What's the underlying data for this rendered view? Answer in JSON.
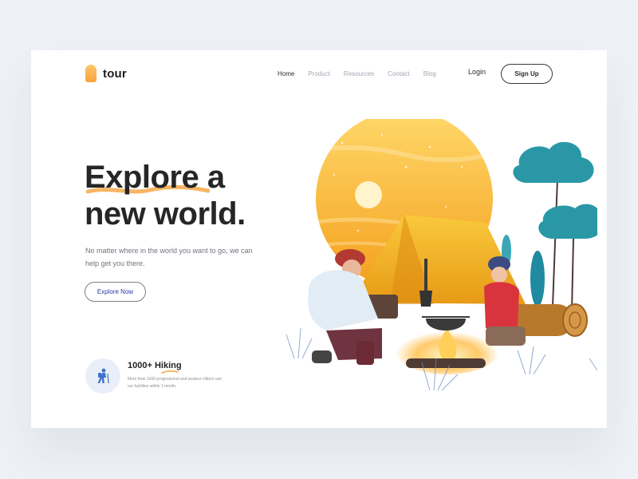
{
  "brand": {
    "name": "tour",
    "accent": "#f7a33a"
  },
  "nav": {
    "items": [
      {
        "label": "Home",
        "active": true
      },
      {
        "label": "Product",
        "active": false
      },
      {
        "label": "Resources",
        "active": false
      },
      {
        "label": "Contact",
        "active": false
      },
      {
        "label": "Blog",
        "active": false
      }
    ],
    "login_label": "Login",
    "signup_label": "Sign Up"
  },
  "hero": {
    "title_line1": "Explore a",
    "title_line2": "new world.",
    "subtitle": "No matter where in the world you want to go, we can help get you there.",
    "cta_label": "Explore Now"
  },
  "stat": {
    "title": "1000+ Hiking",
    "description": "More than 1000 progessional and acateur clibers use our facilities within 1 month.",
    "icon": "hiker-icon"
  },
  "colors": {
    "background": "#eef1f5",
    "card": "#ffffff",
    "sun_gradient": [
      "#ffd56a",
      "#f5a321"
    ],
    "tree": "#2b98a8",
    "cta_text": "#2c3aa8"
  }
}
